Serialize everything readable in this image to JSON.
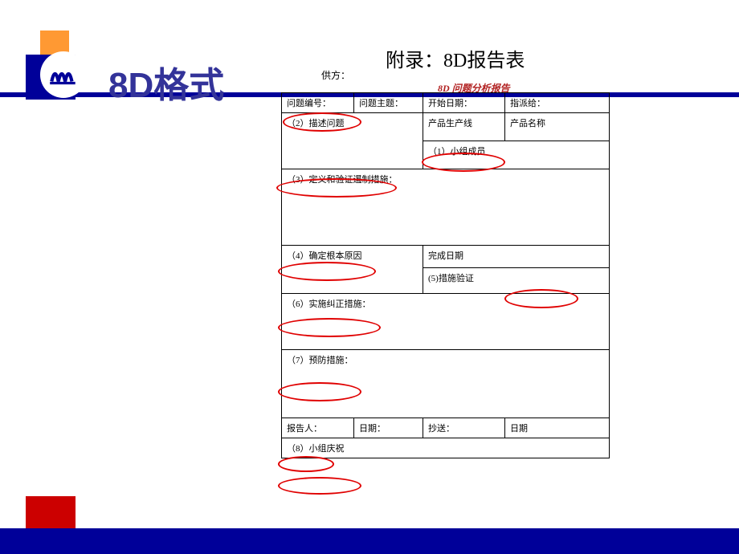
{
  "title": "8D格式",
  "appendix_title": "附录：8D报告表",
  "supplier_label": "供方：",
  "report_title": "8D 问题分析报告",
  "row1": {
    "c1": "问题编号：",
    "c2": "问题主题：",
    "c3": "开始日期：",
    "c4": "指派给："
  },
  "row2": {
    "c1": "（2）描述问题",
    "c3": "产品生产线",
    "c4": "产品名称"
  },
  "row3": {
    "c3": "（1）小组成员"
  },
  "row4": {
    "c1": "（3）定义和验证遏制措施："
  },
  "row5": {
    "c1": "（4）确定根本原因",
    "c3": "完成日期"
  },
  "row6": {
    "c3": "(5)措施验证"
  },
  "row7": {
    "c1": "（6）实施纠正措施："
  },
  "row8": {
    "c1": "（7）预防措施："
  },
  "row9": {
    "c1": "报告人：",
    "c2": "日期：",
    "c3": "抄送：",
    "c4": "日期"
  },
  "row10": {
    "c1": "（8）小组庆祝"
  }
}
